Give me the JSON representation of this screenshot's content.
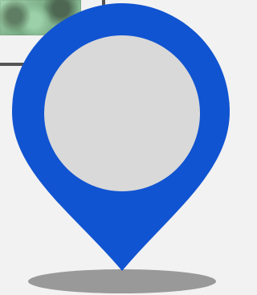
{
  "marker": {
    "icon": "map-pin-icon",
    "pin_color": "#1154d1",
    "center_color": "#d9d9d9",
    "shadow_color": "#999999"
  },
  "background": {
    "image_description_icon": "image-thumbnail-icon",
    "thumbnail_colors": [
      "#9bd0a8",
      "#77a982",
      "#5f7d62"
    ]
  }
}
